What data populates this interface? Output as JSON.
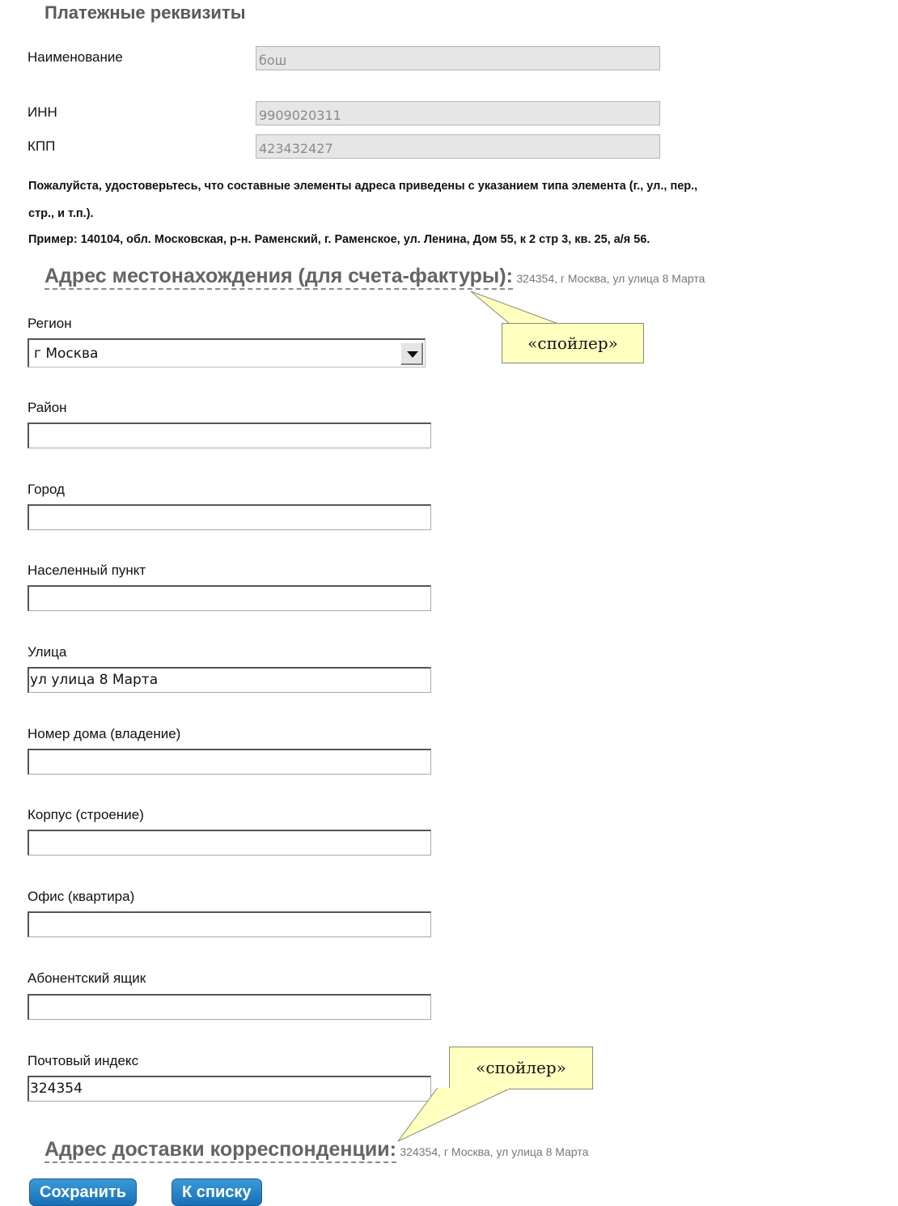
{
  "page": {
    "heading": "Платежные реквизиты",
    "fields_readonly": [
      {
        "label": "Наименование",
        "value": "бош"
      },
      {
        "label": "ИНН",
        "value": "9909020311"
      },
      {
        "label": "КПП",
        "value": "423432427"
      }
    ],
    "notes": {
      "line1": "Пожалуйста, удостоверьтесь, что составные элементы адреса приведены с указанием типа элемента (г., ул., пер.,",
      "line2": "стр., и т.п.).",
      "line3": "Пример: 140104, обл. Московская, р-н. Раменский, г. Раменское, ул. Ленина, Дом 55, к 2 стр 3, кв. 25, а/я 56."
    },
    "legal_address": {
      "title": "Адрес местонахождения (для счета-фактуры):",
      "summary": "324354, г Москва, ул улица 8 Марта"
    },
    "region": {
      "label": "Регион",
      "value": "г Москва"
    },
    "address_fields": [
      {
        "label": "Район",
        "value": ""
      },
      {
        "label": "Город",
        "value": ""
      },
      {
        "label": "Населенный пункт",
        "value": ""
      },
      {
        "label": "Улица",
        "value": "ул улица 8 Марта"
      },
      {
        "label": "Номер дома (владение)",
        "value": ""
      },
      {
        "label": "Корпус (строение)",
        "value": ""
      },
      {
        "label": "Офис (квартира)",
        "value": ""
      },
      {
        "label": "Абонентский ящик",
        "value": ""
      },
      {
        "label": "Почтовый индекс",
        "value": "324354"
      }
    ],
    "delivery_address": {
      "title": "Адрес доставки корреспонденции:",
      "summary": "324354, г Москва, ул улица 8 Марта"
    },
    "callouts": [
      "«спойлер»",
      "«спойлер»"
    ],
    "buttons": {
      "save": "Сохранить",
      "to_list": "К списку"
    }
  }
}
